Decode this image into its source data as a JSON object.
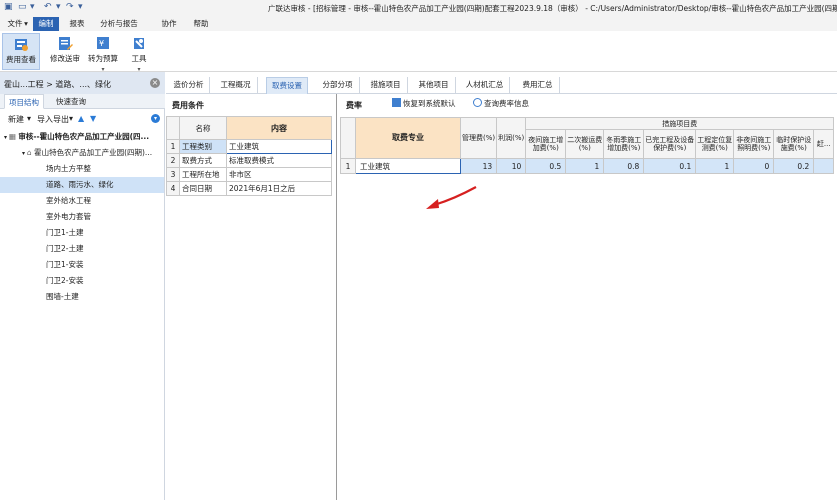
{
  "window": {
    "title": "广联达审核 - [招标管理 - 审核--霍山特色农产品加工产业园(四期)配套工程2023.9.18（审核） - C:/Users/Administrator/Desktop/审核--霍山特色农产品加工产业园(四期)..."
  },
  "menu": {
    "items": [
      "文件",
      "编制",
      "报表",
      "分析与报告",
      "协作",
      "帮助"
    ],
    "active": "编制"
  },
  "ribbon": {
    "buttons": [
      {
        "label": "费用查看",
        "icon": "cost-view-icon"
      },
      {
        "label": "修改送审",
        "icon": "edit-submission-icon"
      },
      {
        "label": "转为预算",
        "icon": "convert-budget-icon"
      },
      {
        "label": "工具",
        "icon": "tools-icon"
      }
    ]
  },
  "left_panel": {
    "header": "霍山...工程 > 道路、...、绿化",
    "tabs": [
      "项目结构",
      "快速查询"
    ],
    "toolbar": {
      "new": "新建",
      "import_export": "导入导出"
    },
    "tree": [
      {
        "label": "审核--霍山特色农产品加工产业园(四...",
        "level": 0
      },
      {
        "label": "霍山特色农产品加工产业园(四期)...",
        "level": 1
      },
      {
        "label": "场内土方平整",
        "level": 2
      },
      {
        "label": "道路、雨污水、绿化",
        "level": 2,
        "selected": true
      },
      {
        "label": "室外给水工程",
        "level": 2
      },
      {
        "label": "室外电力套管",
        "level": 2
      },
      {
        "label": "门卫1-土建",
        "level": 2
      },
      {
        "label": "门卫2-土建",
        "level": 2
      },
      {
        "label": "门卫1-安装",
        "level": 2
      },
      {
        "label": "门卫2-安装",
        "level": 2
      },
      {
        "label": "围墙-土建",
        "level": 2
      }
    ]
  },
  "tabs": [
    "造价分析",
    "工程概况",
    "取费设置",
    "分部分项",
    "措施项目",
    "其他项目",
    "人材机汇总",
    "费用汇总"
  ],
  "active_tab": "取费设置",
  "fee_conditions": {
    "title": "费用条件",
    "headers": [
      "名称",
      "内容"
    ],
    "rows": [
      {
        "num": "1",
        "name": "工程类别",
        "value": "工业建筑"
      },
      {
        "num": "2",
        "name": "取费方式",
        "value": "标准取费模式"
      },
      {
        "num": "3",
        "name": "工程所在地",
        "value": "非市区"
      },
      {
        "num": "4",
        "name": "合同日期",
        "value": "2021年6月1日之后"
      }
    ]
  },
  "fee_rate": {
    "title": "费率",
    "restore_btn": "恢复到系统默认",
    "query_btn": "查询费率信息",
    "headers": {
      "profession": "取费专业",
      "management": "管理费(%)",
      "profit": "利润(%)",
      "group": "措施项目费",
      "sub": [
        "夜间施工增加费(%)",
        "二次搬运费(%)",
        "冬雨季施工增加费(%)",
        "已完工程及设备保护费(%)",
        "工程定位复测费(%)",
        "非夜间施工照明费(%)",
        "临时保护设施费(%)",
        "赶..."
      ]
    },
    "rows": [
      {
        "num": "1",
        "profession": "工业建筑",
        "management": "13",
        "profit": "10",
        "values": [
          "0.5",
          "1",
          "0.8",
          "0.1",
          "1",
          "0",
          "0.2",
          ""
        ]
      }
    ]
  }
}
